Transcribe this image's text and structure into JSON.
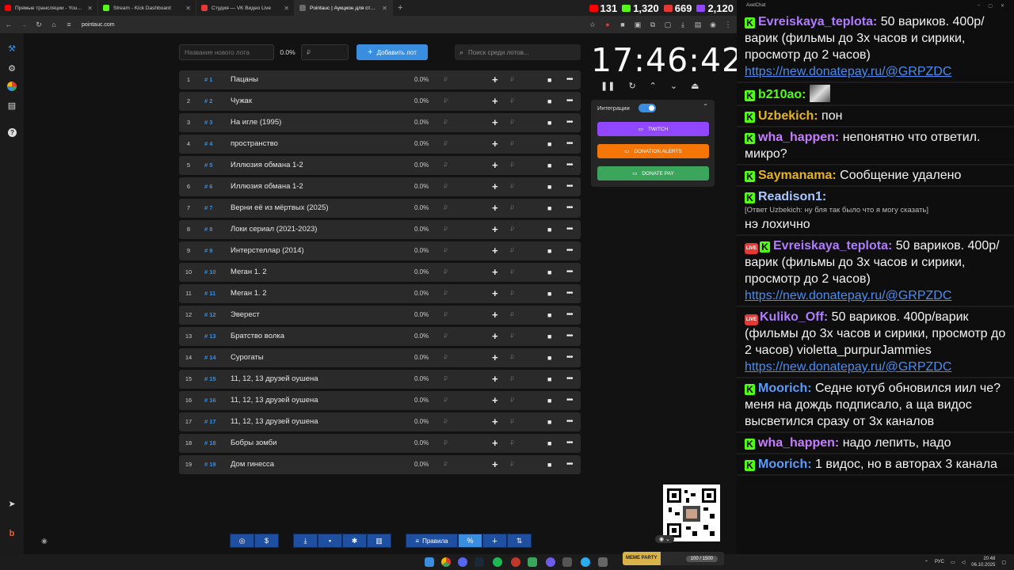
{
  "browser": {
    "tabs": [
      {
        "label": "Прямые трансляции - YouTube",
        "color": "#ff0000",
        "active": false
      },
      {
        "label": "Stream - Kick Dashboard",
        "color": "#53fc18",
        "active": false
      },
      {
        "label": "Студия — VK Видео Live",
        "color": "#e53935",
        "active": false
      },
      {
        "label": "Pointauc | Аукцион для стримеров",
        "color": "#6a6a6a",
        "active": true
      }
    ],
    "url": "pointauc.com",
    "viewer_stats": [
      {
        "platform": "youtube",
        "count": "131",
        "color": "#ff0000"
      },
      {
        "platform": "kick",
        "count": "1,320",
        "color": "#53fc18"
      },
      {
        "platform": "vk",
        "count": "669",
        "color": "#e53935"
      },
      {
        "platform": "twitch",
        "count": "2,120",
        "color": "#9146ff"
      }
    ]
  },
  "auction": {
    "new_lot_placeholder": "Название нового лота",
    "new_lot_percent": "0.0%",
    "amount_placeholder": "₽",
    "add_button": "Добавить лот",
    "search_placeholder": "Поиск среди лотов...",
    "lots": [
      {
        "index": "1",
        "num": "# 1",
        "name": "Пацаны",
        "percent": "0.0%"
      },
      {
        "index": "2",
        "num": "# 2",
        "name": "Чужак",
        "percent": "0.0%"
      },
      {
        "index": "3",
        "num": "# 3",
        "name": "На игле (1995)",
        "percent": "0.0%"
      },
      {
        "index": "4",
        "num": "# 4",
        "name": "пространство",
        "percent": "0.0%"
      },
      {
        "index": "5",
        "num": "# 5",
        "name": "Иллюзия обмана 1-2",
        "percent": "0.0%"
      },
      {
        "index": "6",
        "num": "# 6",
        "name": "Иллюзия обмана 1-2",
        "percent": "0.0%"
      },
      {
        "index": "7",
        "num": "# 7",
        "name": "Верни её из мёртвых (2025)",
        "percent": "0.0%"
      },
      {
        "index": "8",
        "num": "# 8",
        "name": "Локи сериал (2021-2023)",
        "percent": "0.0%"
      },
      {
        "index": "9",
        "num": "# 9",
        "name": "Интерстеллар (2014)",
        "percent": "0.0%"
      },
      {
        "index": "10",
        "num": "# 10",
        "name": "Меган 1. 2",
        "percent": "0.0%"
      },
      {
        "index": "11",
        "num": "# 11",
        "name": "Меган 1. 2",
        "percent": "0.0%"
      },
      {
        "index": "12",
        "num": "# 12",
        "name": "Эверест",
        "percent": "0.0%"
      },
      {
        "index": "13",
        "num": "# 13",
        "name": "Братство волка",
        "percent": "0.0%"
      },
      {
        "index": "14",
        "num": "# 14",
        "name": "Сурогаты",
        "percent": "0.0%"
      },
      {
        "index": "15",
        "num": "# 15",
        "name": "11, 12, 13 друзей оушена",
        "percent": "0.0%"
      },
      {
        "index": "16",
        "num": "# 16",
        "name": "11, 12, 13 друзей оушена",
        "percent": "0.0%"
      },
      {
        "index": "17",
        "num": "# 17",
        "name": "11, 12, 13 друзей оушена",
        "percent": "0.0%"
      },
      {
        "index": "18",
        "num": "# 18",
        "name": "Бобры зомби",
        "percent": "0.0%"
      },
      {
        "index": "19",
        "num": "# 19",
        "name": "Дом гинесса",
        "percent": "0.0%"
      }
    ],
    "timer": "17:46:42",
    "integrations": {
      "title": "Интеграции",
      "buttons": [
        {
          "label": "TWITCH",
          "color": "#9146ff"
        },
        {
          "label": "DONATION ALERTS",
          "color": "#f57507"
        },
        {
          "label": "DONATE PAY",
          "color": "#3ba55c"
        }
      ]
    },
    "rules_label": "Правила"
  },
  "chat": {
    "title": "AxelChat",
    "messages": [
      {
        "user": "Evreiskaya_teplota",
        "user_color": "#b07cff",
        "badge": "kick",
        "text": "50 вариков. 400р/варик (фильмы до 3х часов и сирики, просмотр до 2 часов)",
        "link": "https://new.donatepay.ru/@GRPZDC"
      },
      {
        "user": "b210ao",
        "user_color": "#53fc18",
        "badge": "kick",
        "text": "",
        "link": ""
      },
      {
        "user": "Uzbekich",
        "user_color": "#e6b422",
        "badge": "kick",
        "text": "пон",
        "link": ""
      },
      {
        "user": "wha_happen",
        "user_color": "#c77dff",
        "badge": "kick",
        "text": "непонятно что ответил. микро?",
        "link": ""
      },
      {
        "user": "Saymanama",
        "user_color": "#e6b422",
        "badge": "kick",
        "text": "Сообщение удалено",
        "link": ""
      },
      {
        "user": "Readison1",
        "user_color": "#a8c8ff",
        "badge": "kick",
        "reply": "[Ответ Uzbekich: ну бля так было что я могу сказать]",
        "text": "нэ лохично",
        "link": ""
      },
      {
        "user": "Evreiskaya_teplota",
        "user_color": "#b07cff",
        "badge": "live",
        "text": "50 вариков. 400р/варик (фильмы до 3х часов и сирики, просмотр до 2 часов)",
        "link": "https://new.donatepay.ru/@GRPZDC"
      },
      {
        "user": "Kuliko_Off",
        "user_color": "#b07cff",
        "badge": "live-only",
        "text": "50 вариков. 400р/варик (фильмы до 3х часов и сирики, просмотр до 2 часов) violetta_purpurJammies",
        "link": "https://new.donatepay.ru/@GRPZDC"
      },
      {
        "user": "Moorich",
        "user_color": "#5b9bff",
        "badge": "kick",
        "text": "Седне ютуб обновился иил че? меня на дождь подписало, а ща видос высветился сразу от 3х каналов",
        "link": ""
      },
      {
        "user": "wha_happen",
        "user_color": "#c77dff",
        "badge": "kick",
        "text": "надо лепить, надо",
        "link": ""
      },
      {
        "user": "Moorich",
        "user_color": "#5b9bff",
        "badge": "kick",
        "text": "1 видос, но в авторах 3 канала",
        "link": ""
      }
    ]
  },
  "taskbar": {
    "hype_label": "MEME PARTY",
    "hype_progress": "100 / 1500",
    "lang": "РУС",
    "time": "20:48",
    "date": "06.10.2025"
  }
}
